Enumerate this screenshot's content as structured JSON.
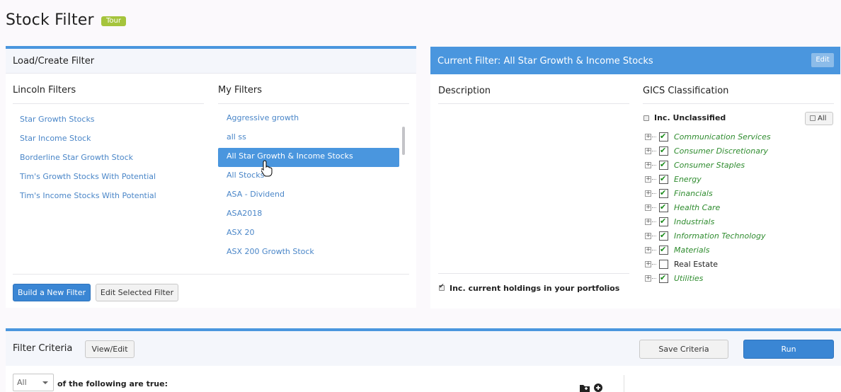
{
  "page": {
    "title": "Stock Filter",
    "tour_label": "Tour"
  },
  "load_panel": {
    "title": "Load/Create Filter",
    "lincoln_title": "Lincoln Filters",
    "my_title": "My Filters",
    "lincoln_filters": [
      "Star Growth Stocks",
      "Star Income Stock",
      "Borderline Star Growth Stock",
      "Tim's Growth Stocks With Potential",
      "Tim's Income Stocks With Potential"
    ],
    "my_filters": [
      "Aggressive growth",
      "all ss",
      "All Star Growth & Income Stocks",
      "All Stocks",
      "ASA - Dividend",
      "ASA2018",
      "ASX 20",
      "ASX 200 Growth Stock"
    ],
    "selected_filter": "All Star Growth & Income Stocks",
    "build_button": "Build a New Filter",
    "edit_button": "Edit Selected Filter"
  },
  "current_filter": {
    "title": "Current Filter: All Star Growth & Income Stocks",
    "edit_label": "Edit",
    "description_title": "Description",
    "gics_title": "GICS Classification",
    "inc_unclassified_label": "Inc. Unclassified",
    "inc_unclassified_checked": false,
    "all_label": "All",
    "holdings_label": "Inc. current holdings in your portfolios",
    "holdings_checked": true,
    "gics_items": [
      {
        "label": "Communication Services",
        "checked": true
      },
      {
        "label": "Consumer Discretionary",
        "checked": true
      },
      {
        "label": "Consumer Staples",
        "checked": true
      },
      {
        "label": "Energy",
        "checked": true
      },
      {
        "label": "Financials",
        "checked": true
      },
      {
        "label": "Health Care",
        "checked": true
      },
      {
        "label": "Industrials",
        "checked": true
      },
      {
        "label": "Information Technology",
        "checked": true
      },
      {
        "label": "Materials",
        "checked": true
      },
      {
        "label": "Real Estate",
        "checked": false
      },
      {
        "label": "Utilities",
        "checked": true
      }
    ]
  },
  "criteria": {
    "title": "Filter Criteria",
    "view_edit_label": "View/Edit",
    "save_label": "Save Criteria",
    "run_label": "Run",
    "match_select_value": "All",
    "following_text": "of the following are true:"
  },
  "colors": {
    "accent": "#4a96de",
    "link": "#4a86c8",
    "tour_badge": "#a5c43c",
    "gics_text": "#2f8c2f"
  }
}
